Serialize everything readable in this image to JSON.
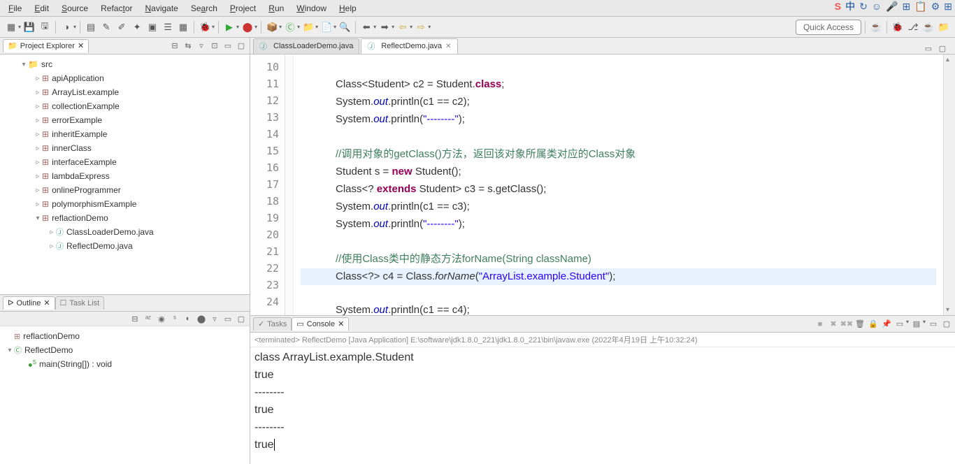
{
  "menu": {
    "file": "File",
    "edit": "Edit",
    "source": "Source",
    "refactor": "Refactor",
    "navigate": "Navigate",
    "search": "Search",
    "project": "Project",
    "run": "Run",
    "window": "Window",
    "help": "Help"
  },
  "toolbar": {
    "quick_access": "Quick Access"
  },
  "explorer": {
    "title": "Project Explorer",
    "src": "src",
    "packages": [
      "apiApplication",
      "ArrayList.example",
      "collectionExample",
      "errorExample",
      "inheritExample",
      "innerClass",
      "interfaceExample",
      "lambdaExpress",
      "onlineProgrammer",
      "polymorphismExample",
      "reflactionDemo"
    ],
    "files": [
      "ClassLoaderDemo.java",
      "ReflectDemo.java"
    ]
  },
  "outline": {
    "title": "Outline",
    "tasklist": "Task List",
    "pkg": "reflactionDemo",
    "cls": "ReflectDemo",
    "method": "main(String[]) : void"
  },
  "editor": {
    "tab1": "ClassLoaderDemo.java",
    "tab2": "ReflectDemo.java",
    "lines": {
      "start": 10,
      "end": 24
    },
    "code": {
      "l11a": "Class<Student> c2 = Student.",
      "l11b": "class",
      "l11c": ";",
      "l12a": "System.",
      "l12b": "out",
      "l12c": ".println(c1 == c2);",
      "l13a": "System.",
      "l13b": "out",
      "l13c": ".println(",
      "l13d": "\"--------\"",
      "l13e": ");",
      "l15": "//调用对象的getClass()方法，返回该对象所属类对应的Class对象",
      "l16a": "Student s = ",
      "l16b": "new",
      "l16c": " Student();",
      "l17a": "Class<? ",
      "l17b": "extends",
      "l17c": " Student> c3 = s.getClass();",
      "l18a": "System.",
      "l18b": "out",
      "l18c": ".println(c1 == c3);",
      "l19a": "System.",
      "l19b": "out",
      "l19c": ".println(",
      "l19d": "\"--------\"",
      "l19e": ");",
      "l21": "//使用Class类中的静态方法forName(String className)",
      "l22a": "Class<?> c4 = Class.",
      "l22b": "forName",
      "l22c": "(",
      "l22d": "\"ArrayList.example.Student\"",
      "l22e": ");",
      "l23a": "System.",
      "l23b": "out",
      "l23c": ".println(c1 == c4);",
      "l24": "}"
    }
  },
  "console": {
    "tasks_tab": "Tasks",
    "title": "Console",
    "status": "<terminated> ReflectDemo [Java Application] E:\\software\\jdk1.8.0_221\\jdk1.8.0_221\\bin\\javaw.exe (2022年4月19日 上午10:32:24)",
    "l1": "class ArrayList.example.Student",
    "l2": "true",
    "l3": "--------",
    "l4": "true",
    "l5": "--------",
    "l6": "true"
  }
}
